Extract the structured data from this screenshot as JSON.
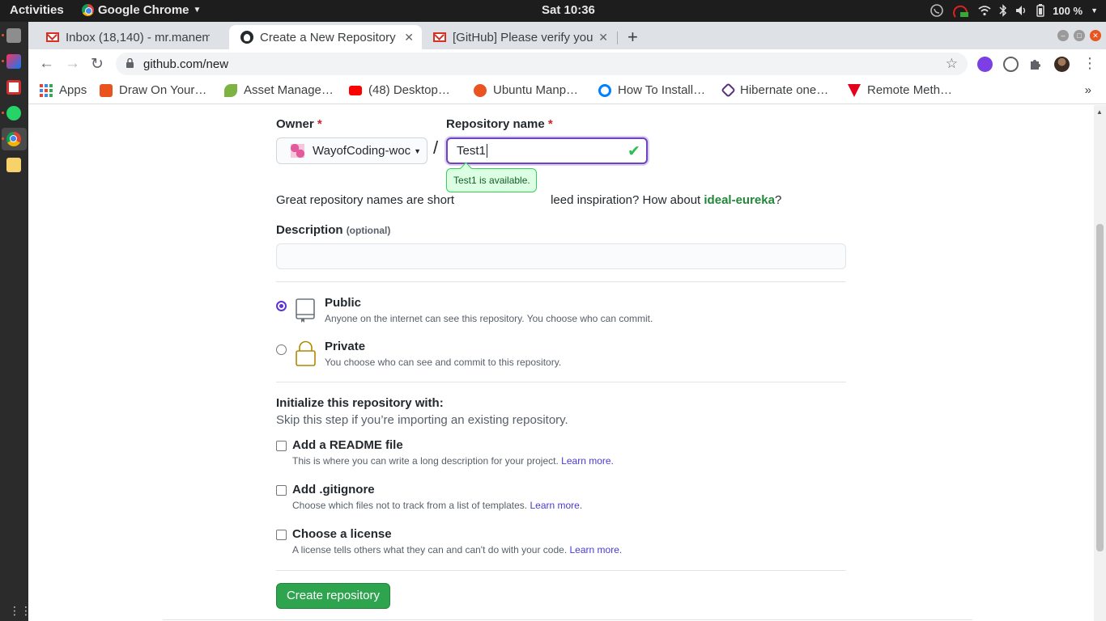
{
  "ubuntu_bar": {
    "activities": "Activities",
    "app_name": "Google Chrome",
    "clock": "Sat 10:36",
    "battery": "100 %"
  },
  "tabs": [
    {
      "title": "Inbox (18,140) - mr.manem",
      "icon": "gmail-icon"
    },
    {
      "title": "Create a New Repository",
      "icon": "github-icon"
    },
    {
      "title": "[GitHub] Please verify you",
      "icon": "gmail-icon"
    }
  ],
  "toolbar": {
    "url": "github.com/new"
  },
  "bookmarks": [
    {
      "label": "Apps",
      "color": "#4285f4"
    },
    {
      "label": "Draw On Your…",
      "color": "#e8531f"
    },
    {
      "label": "Asset Manage…",
      "color": "#7cb342"
    },
    {
      "label": "(48) Desktop…",
      "color": "#ff0000"
    },
    {
      "label": "Ubuntu Manp…",
      "color": "#e95420"
    },
    {
      "label": "How To Install…",
      "color": "#0080ff"
    },
    {
      "label": "Hibernate one…",
      "color": "#59307e"
    },
    {
      "label": "Remote Meth…",
      "color": "#e4001b"
    }
  ],
  "form": {
    "owner_label": "Owner",
    "owner_value": "WayofCoding-woc",
    "repo_label": "Repository name",
    "repo_value": "Test1",
    "required_mark": "*",
    "slash": "/",
    "tooltip": "Test1 is available.",
    "hint_prefix": "Great repository names are short",
    "hint_suffix": "leed inspiration? How about",
    "hint_suggestion": "ideal-eureka",
    "hint_end": "?",
    "description_label": "Description",
    "description_optional": "(optional)",
    "description_value": "",
    "visibility": [
      {
        "title": "Public",
        "desc": "Anyone on the internet can see this repository. You choose who can commit.",
        "selected": true
      },
      {
        "title": "Private",
        "desc": "You choose who can see and commit to this repository.",
        "selected": false
      }
    ],
    "init_title": "Initialize this repository with:",
    "init_subtitle": "Skip this step if you’re importing an existing repository.",
    "init_options": [
      {
        "title": "Add a README file",
        "desc": "This is where you can write a long description for your project.",
        "link": "Learn more.",
        "checked": false
      },
      {
        "title": "Add .gitignore",
        "desc": "Choose which files not to track from a list of templates.",
        "link": "Learn more.",
        "checked": false
      },
      {
        "title": "Choose a license",
        "desc": "A license tells others what they can and can't do with your code.",
        "link": "Learn more.",
        "checked": false
      }
    ],
    "submit_label": "Create repository"
  },
  "colors": {
    "accent_green": "#2ea44f",
    "focus_purple": "#6f42c1",
    "radio_purple": "#5c33d6"
  }
}
